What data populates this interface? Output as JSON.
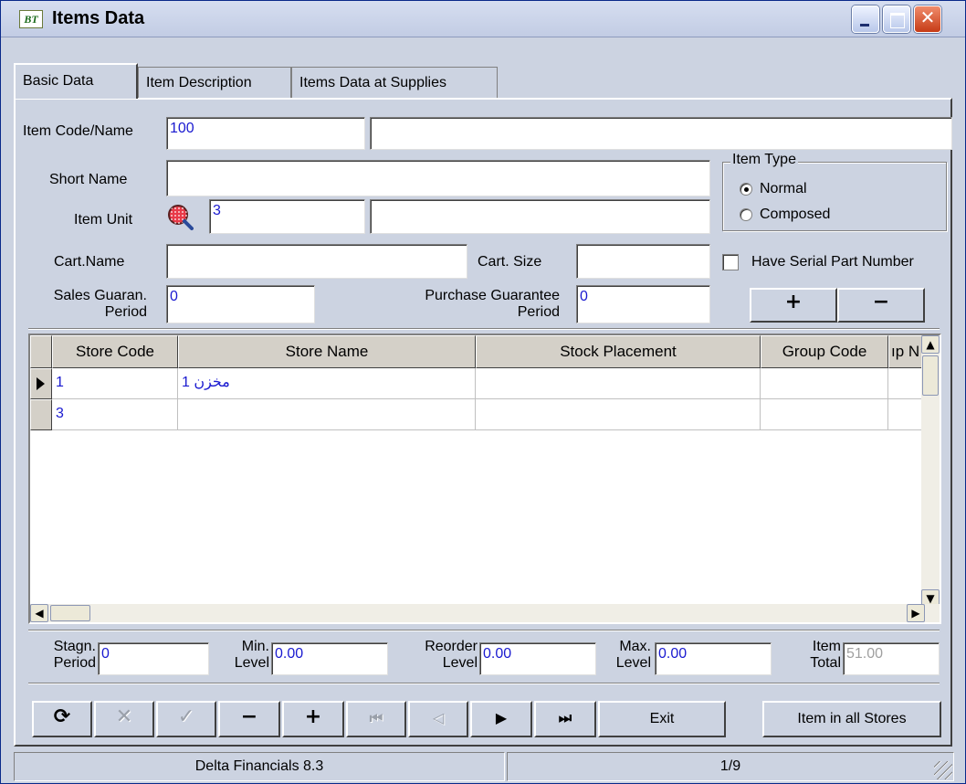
{
  "window": {
    "title": "Items Data",
    "logo_text": "BT"
  },
  "tabs": [
    {
      "label": "Basic Data",
      "active": true
    },
    {
      "label": "Item Description",
      "active": false
    },
    {
      "label": "Items Data at Supplies",
      "active": false
    }
  ],
  "form": {
    "item_code_label": "Item Code/Name",
    "item_code": "100",
    "item_name": "",
    "short_name_label": "Short Name",
    "short_name": "",
    "item_unit_label": "Item Unit",
    "item_unit_code": "3",
    "item_unit_name": "",
    "cart_name_label": "Cart.Name",
    "cart_name": "",
    "cart_size_label": "Cart. Size",
    "cart_size": "",
    "sales_guar_label_1": "Sales Guaran.",
    "sales_guar_label_2": "Period",
    "sales_guar": "0",
    "purchase_guar_label_1": "Purchase Guarantee",
    "purchase_guar_label_2": "Period",
    "purchase_guar": "0",
    "item_type_title": "Item Type",
    "item_type_normal": "Normal",
    "item_type_composed": "Composed",
    "item_type_selected": "Normal",
    "serial_label": "Have Serial Part Number",
    "serial_checked": false,
    "add_glyph": "+",
    "remove_glyph": "−"
  },
  "grid": {
    "columns": [
      "Store Code",
      "Store Name",
      "Stock Placement",
      "Group Code",
      "ıp N"
    ],
    "rows": [
      {
        "store_code": "1",
        "store_name": "مخزن 1",
        "stock_placement": "",
        "group_code": "",
        "extra": "",
        "current": true
      },
      {
        "store_code": "3",
        "store_name": "",
        "stock_placement": "",
        "group_code": "",
        "extra": "",
        "current": false
      }
    ]
  },
  "levels": {
    "stagn_label_1": "Stagn.",
    "stagn_label_2": "Period",
    "stagn": "0",
    "min_label_1": "Min.",
    "min_label_2": "Level",
    "min": "0.00",
    "reorder_label_1": "Reorder",
    "reorder_label_2": "Level",
    "reorder": "0.00",
    "max_label_1": "Max.",
    "max_label_2": "Level",
    "max": "0.00",
    "total_label_1": "Item",
    "total_label_2": "Total",
    "total": "51.00"
  },
  "toolbar": {
    "refresh": "⟳",
    "cancel": "✕",
    "confirm": "✓",
    "delete": "−",
    "add": "+",
    "first": "⏮",
    "prev": "◁",
    "next": "▶",
    "last": "⏭",
    "exit_label": "Exit",
    "all_stores_label": "Item in all Stores"
  },
  "status": {
    "app": "Delta Financials 8.3",
    "record": "1/9"
  }
}
